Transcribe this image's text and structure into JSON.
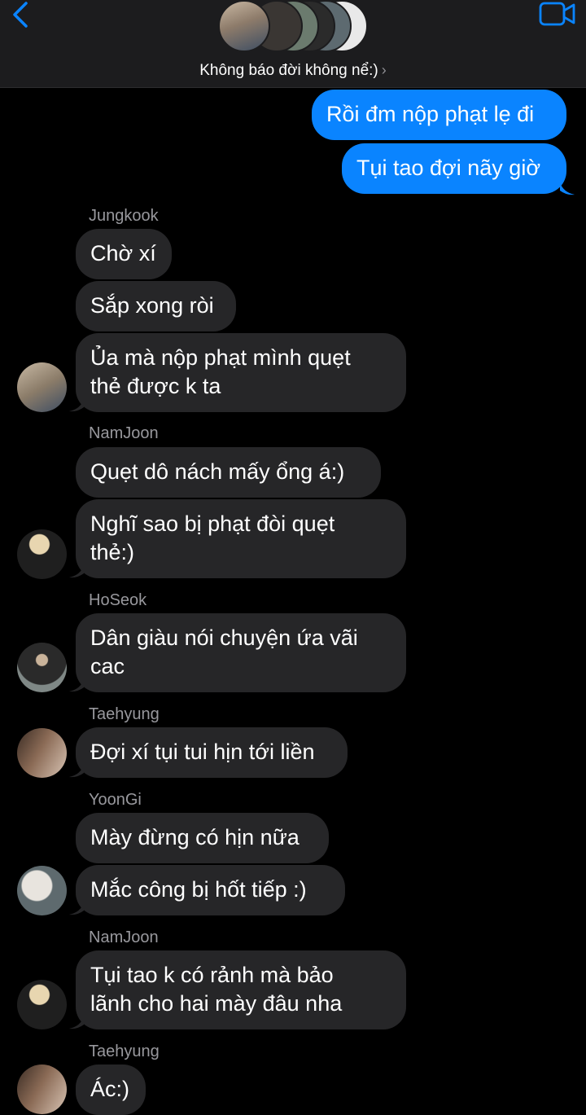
{
  "header": {
    "title": "Không báo đời không nể:)",
    "back_icon": "chevron-left-icon",
    "video_icon": "video-camera-icon",
    "accent": "#0a84ff"
  },
  "messages": {
    "me1": "Rồi đm nộp phạt lẹ đi",
    "me2": "Tụi tao đợi nãy giờ",
    "jk_name": "Jungkook",
    "jk1": "Chờ xí",
    "jk2": "Sắp xong ròi",
    "jk3a": "Ủa mà nộp phạt mình quẹt",
    "jk3b": "thẻ được k ta",
    "nj_name": "NamJoon",
    "nj1": "Quẹt dô nách mấy ổng á:)",
    "nj2a": "Nghĩ sao bị phạt đòi quẹt",
    "nj2b": "thẻ:)",
    "hs_name": "HoSeok",
    "hs1a": "Dân giàu nói chuyện ứa vãi",
    "hs1b": "cac",
    "th_name": "Taehyung",
    "th1": "Đợi xí tụi tui hịn tới liền",
    "yg_name": "YoonGi",
    "yg1": "Mày đừng có hịn nữa",
    "yg2": "Mắc công bị hốt tiếp :)",
    "nj2_name": "NamJoon",
    "nj3a": "Tụi tao k có rảnh mà bảo",
    "nj3b": "lãnh cho hai mày đâu nha",
    "th2_name": "Taehyung",
    "th2": "Ác:)"
  }
}
